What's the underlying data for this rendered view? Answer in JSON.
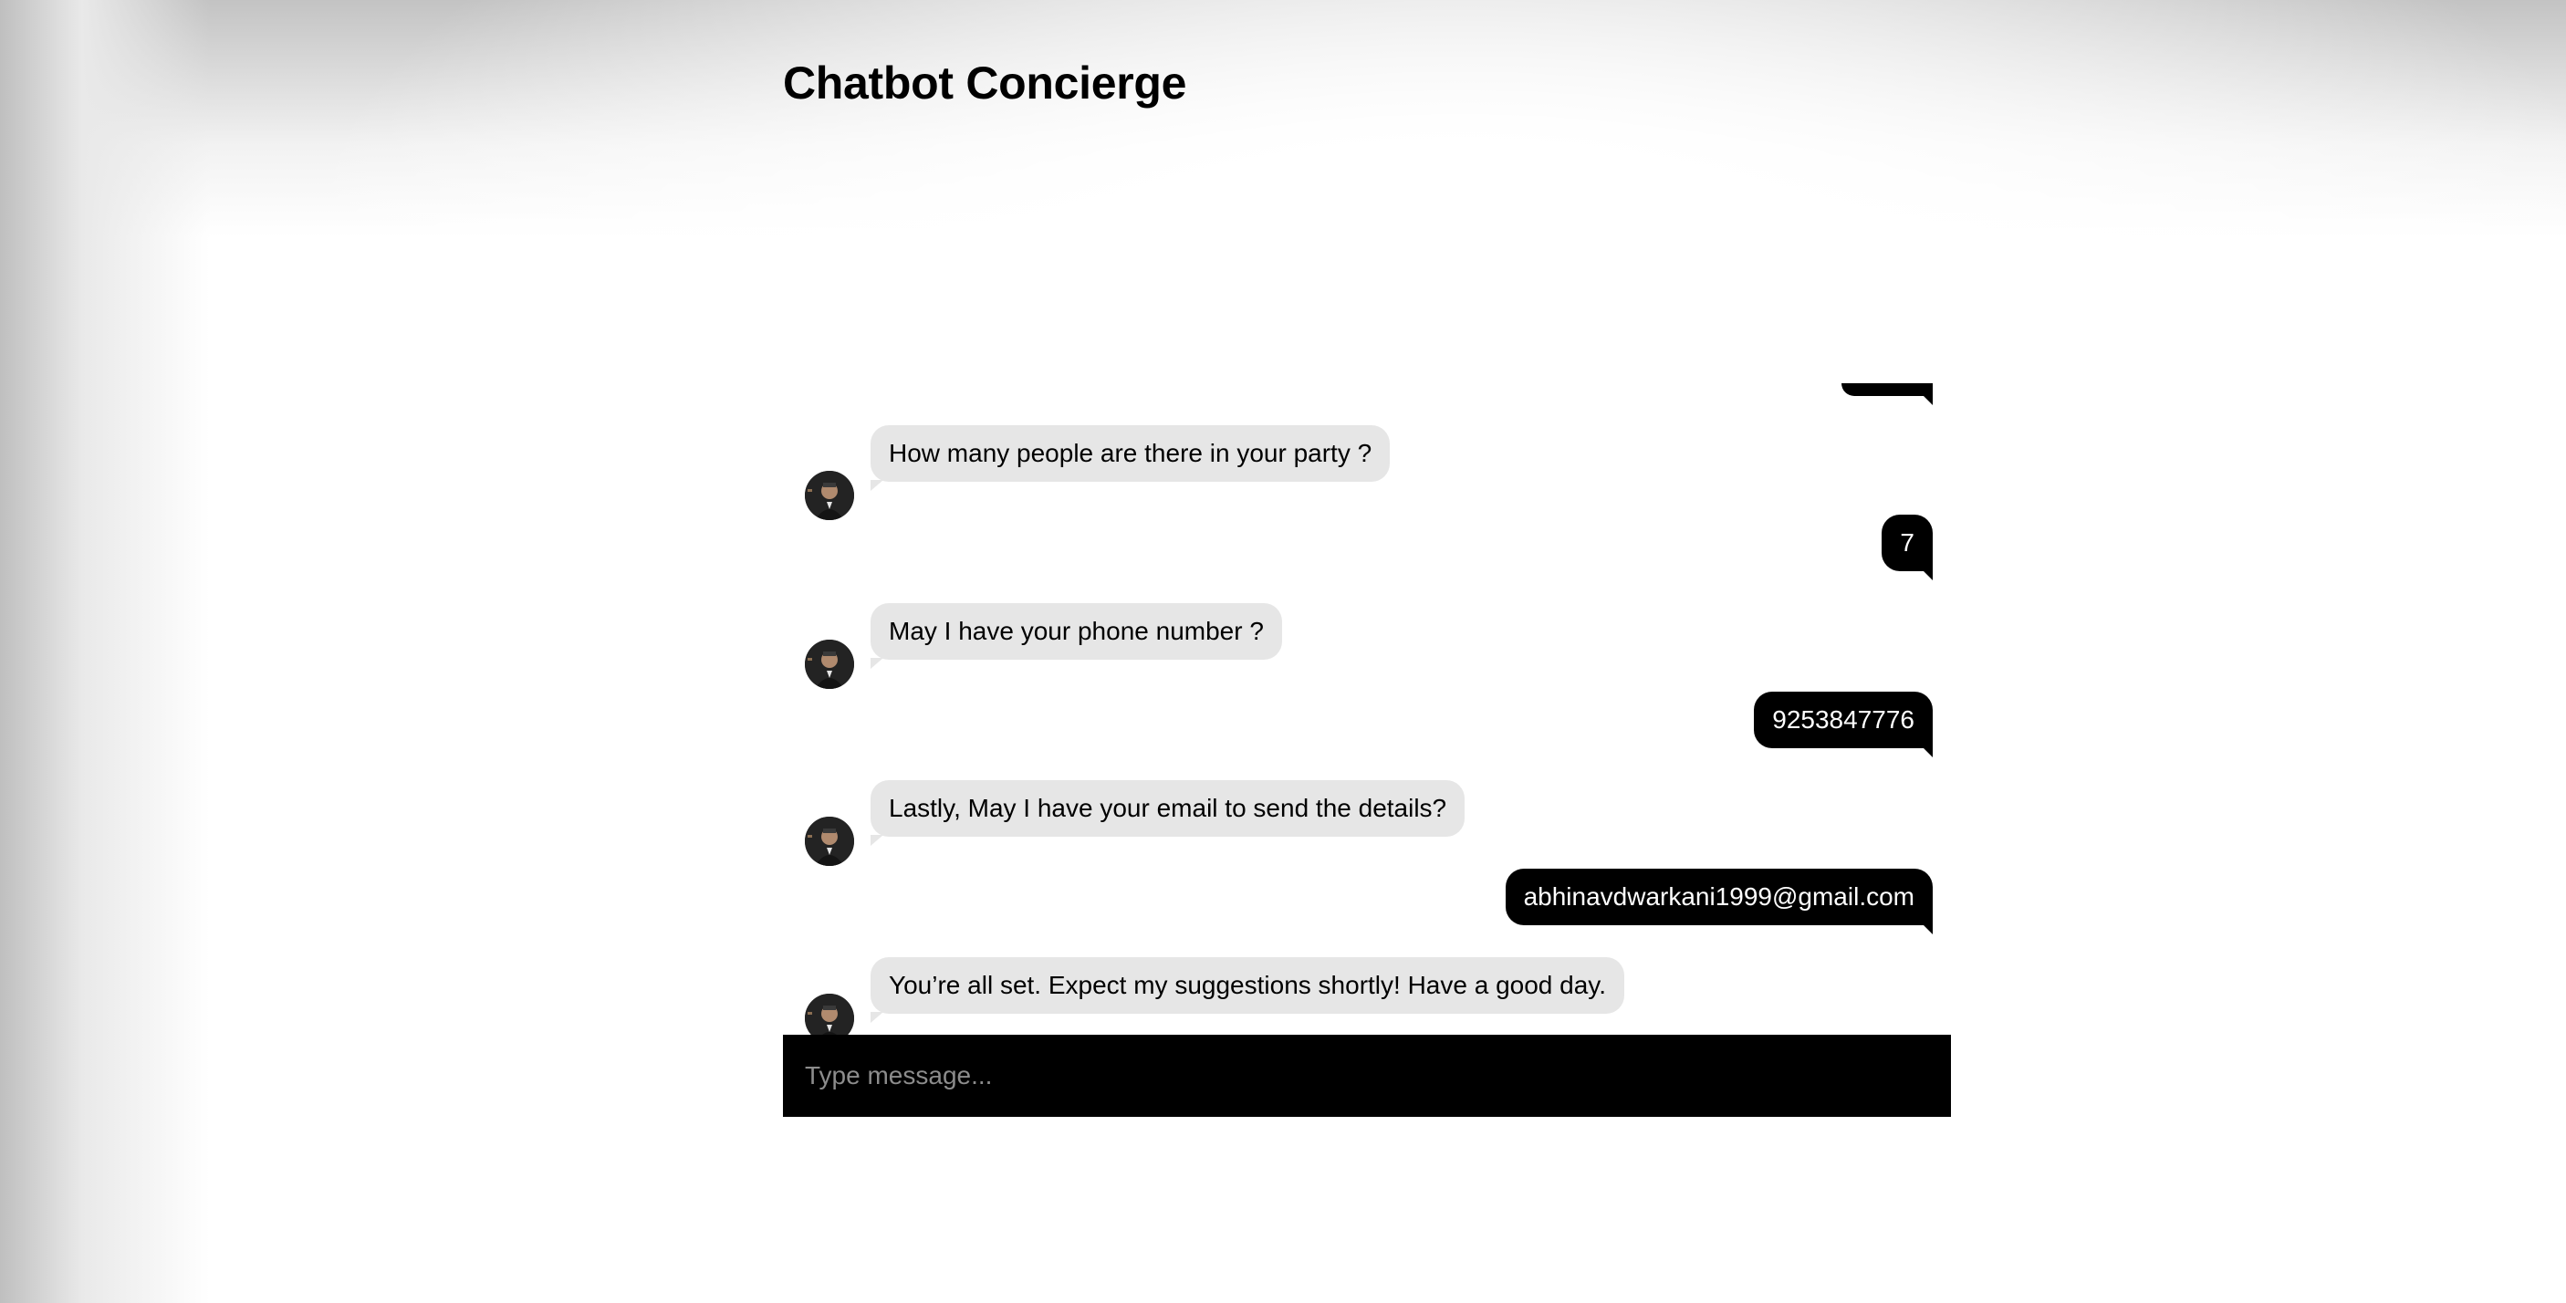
{
  "header": {
    "title": "Chatbot Concierge"
  },
  "chat": {
    "messages": [
      {
        "sender": "bot",
        "text": "How many people are there in your party ?"
      },
      {
        "sender": "user",
        "text": "7"
      },
      {
        "sender": "bot",
        "text": "May I have your phone number ?"
      },
      {
        "sender": "user",
        "text": "9253847776"
      },
      {
        "sender": "bot",
        "text": "Lastly, May I have your email to send the details?"
      },
      {
        "sender": "user",
        "text": "abhinavdwarkani1999@gmail.com"
      },
      {
        "sender": "bot",
        "text": "You’re all set. Expect my suggestions shortly! Have a good day."
      }
    ]
  },
  "input": {
    "placeholder": "Type message..."
  },
  "icons": {
    "bot_avatar": "bot-avatar-icon"
  },
  "colors": {
    "bot_bubble": "#e6e6e6",
    "user_bubble": "#000000",
    "input_bar": "#000000"
  }
}
